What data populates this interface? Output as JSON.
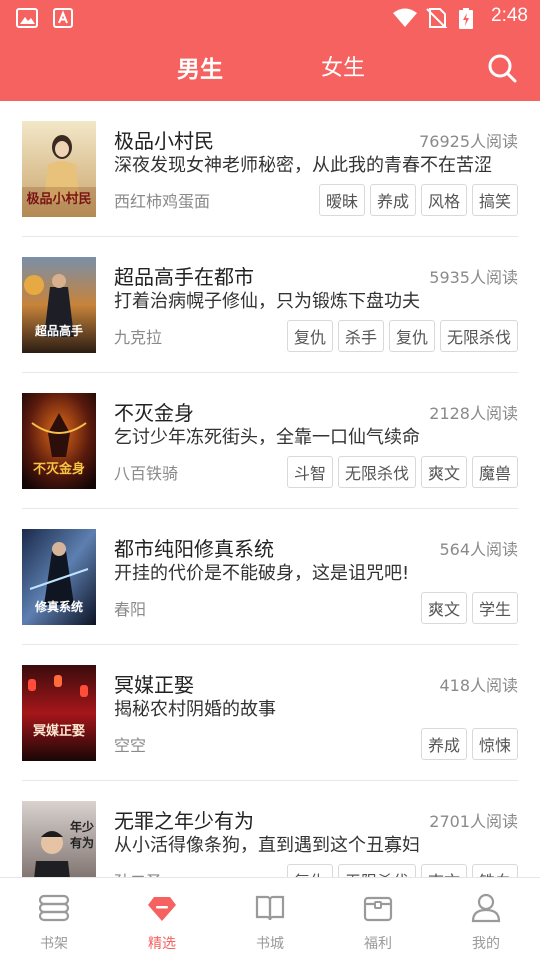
{
  "status": {
    "time": "2:48"
  },
  "header": {
    "tabs": [
      {
        "label": "男生",
        "active": true
      },
      {
        "label": "女生",
        "active": false
      }
    ],
    "search_icon": "search-icon",
    "bg_color": "#f5625f"
  },
  "books": [
    {
      "title": "极品小村民",
      "reads": "76925人阅读",
      "desc": "深夜发现女神老师秘密，从此我的青春不在苦涩",
      "author": "西红柿鸡蛋面",
      "tags": [
        "暧昧",
        "养成",
        "风格",
        "搞笑"
      ],
      "cover_text": "极品小村民"
    },
    {
      "title": "超品高手在都市",
      "reads": "5935人阅读",
      "desc": "打着治病幌子修仙，只为锻炼下盘功夫",
      "author": "九克拉",
      "tags": [
        "复仇",
        "杀手",
        "复仇",
        "无限杀伐"
      ],
      "cover_text": "超品高手"
    },
    {
      "title": "不灭金身",
      "reads": "2128人阅读",
      "desc": "乞讨少年冻死街头，全靠一口仙气续命",
      "author": "八百铁骑",
      "tags": [
        "斗智",
        "无限杀伐",
        "爽文",
        "魔兽"
      ],
      "cover_text": "不灭金身"
    },
    {
      "title": "都市纯阳修真系统",
      "reads": "564人阅读",
      "desc": "开挂的代价是不能破身，这是诅咒吧!",
      "author": "春阳",
      "tags": [
        "爽文",
        "学生"
      ],
      "cover_text": "修真系统"
    },
    {
      "title": "冥媒正娶",
      "reads": "418人阅读",
      "desc": "揭秘农村阴婚的故事",
      "author": "空空",
      "tags": [
        "养成",
        "惊悚"
      ],
      "cover_text": "冥媒正娶"
    },
    {
      "title": "无罪之年少有为",
      "reads": "2701人阅读",
      "desc": "从小活得像条狗，直到遇到这个丑寡妇",
      "author": "孙二圣",
      "tags": [
        "复仇",
        "无限杀伐",
        "爽文",
        "铁血"
      ],
      "cover_text": "年少有为"
    }
  ],
  "bottom_nav": [
    {
      "label": "书架",
      "icon": "bookshelf-icon",
      "active": false
    },
    {
      "label": "精选",
      "icon": "gem-icon",
      "active": true
    },
    {
      "label": "书城",
      "icon": "open-book-icon",
      "active": false
    },
    {
      "label": "福利",
      "icon": "gift-box-icon",
      "active": false
    },
    {
      "label": "我的",
      "icon": "user-icon",
      "active": false
    }
  ]
}
